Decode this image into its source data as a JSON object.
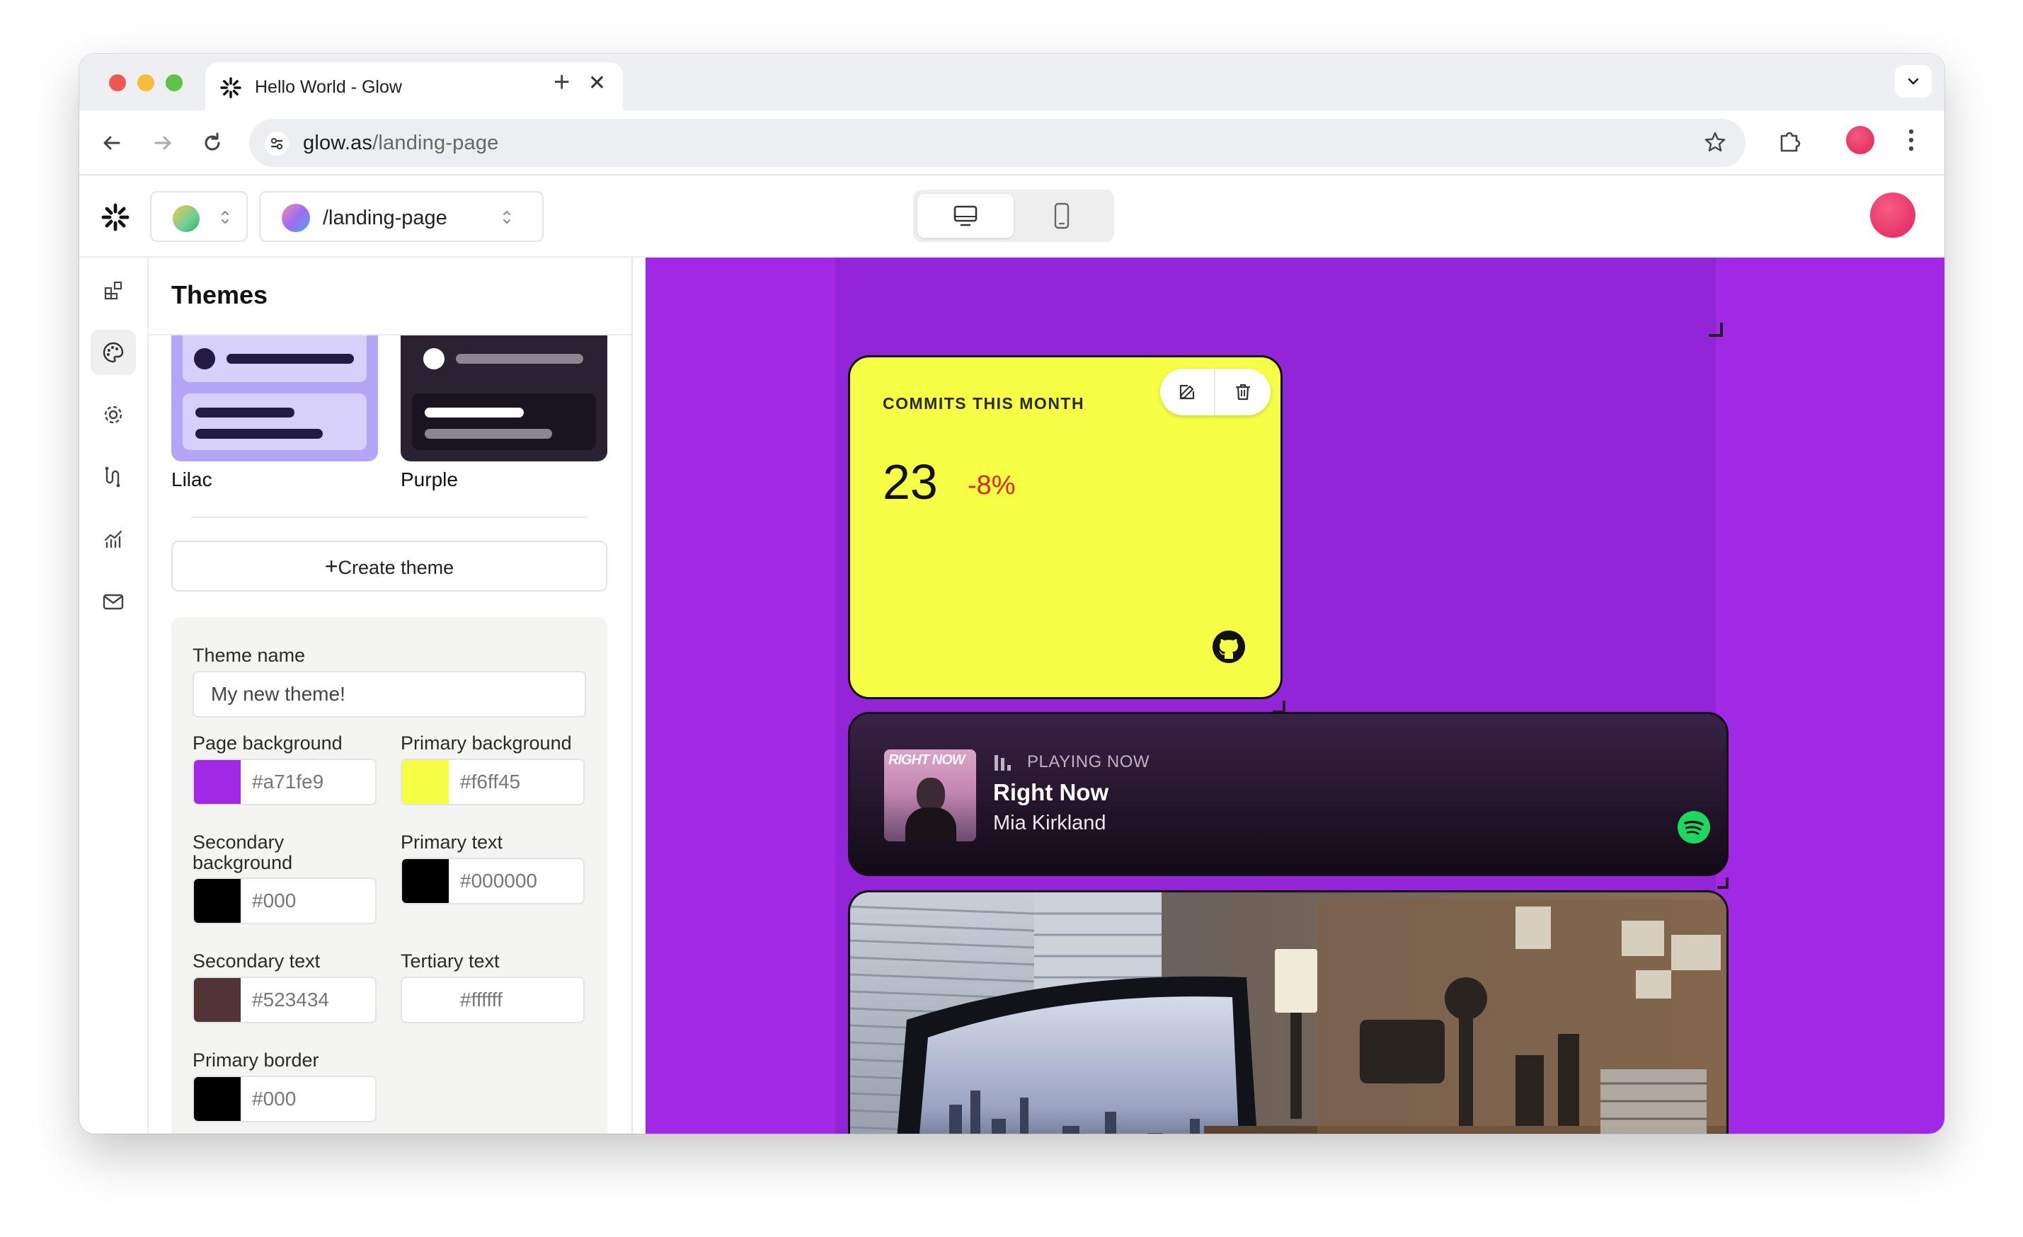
{
  "browser": {
    "tab_title": "Hello World - Glow",
    "url_host": "glow.as",
    "url_path": "/landing-page"
  },
  "header": {
    "page_path": "/landing-page",
    "device_modes": [
      "desktop",
      "mobile"
    ],
    "active_device": "desktop"
  },
  "sidebar_icons": [
    "blocks-icon",
    "palette-icon",
    "settings-icon",
    "integrations-icon",
    "analytics-icon",
    "mail-icon"
  ],
  "themes": {
    "title": "Themes",
    "presets": [
      {
        "name": "Lilac",
        "colors": {
          "bg": "#b4a5f7",
          "card": "#d7d0fb",
          "ink": "#231a48"
        }
      },
      {
        "name": "Purple",
        "colors": {
          "bg": "#2a2232",
          "card": "#1a1420",
          "ink": "#ffffff"
        }
      }
    ],
    "create_label": "Create theme",
    "form": {
      "theme_name_label": "Theme name",
      "theme_name_value": "My new theme!",
      "fields": [
        {
          "label": "Page background",
          "value": "#a71fe9",
          "swatch": "#a129e5"
        },
        {
          "label": "Primary background",
          "value": "#f6ff45",
          "swatch": "#f6ff45"
        },
        {
          "label": "Secondary background",
          "value": "#000",
          "swatch": "#000000"
        },
        {
          "label": "Primary text",
          "value": "#000000",
          "swatch": "#000000"
        },
        {
          "label": "Secondary text",
          "value": "#523434",
          "swatch": "#523434"
        },
        {
          "label": "Tertiary text",
          "value": "#ffffff",
          "swatch": "#ffffff"
        },
        {
          "label": "Primary border",
          "value": "#000",
          "swatch": "#000000"
        }
      ]
    }
  },
  "canvas": {
    "commits_card": {
      "title": "COMMITS THIS MONTH",
      "value": "23",
      "delta": "-8%",
      "source_icon": "github-icon"
    },
    "music_card": {
      "status": "PLAYING NOW",
      "track": "Right Now",
      "artist": "Mia Kirkland",
      "album_art_text": "RIGHT NOW",
      "source_icon": "spotify-icon"
    },
    "photo_card": {
      "description_icon": "desk-photo"
    }
  }
}
